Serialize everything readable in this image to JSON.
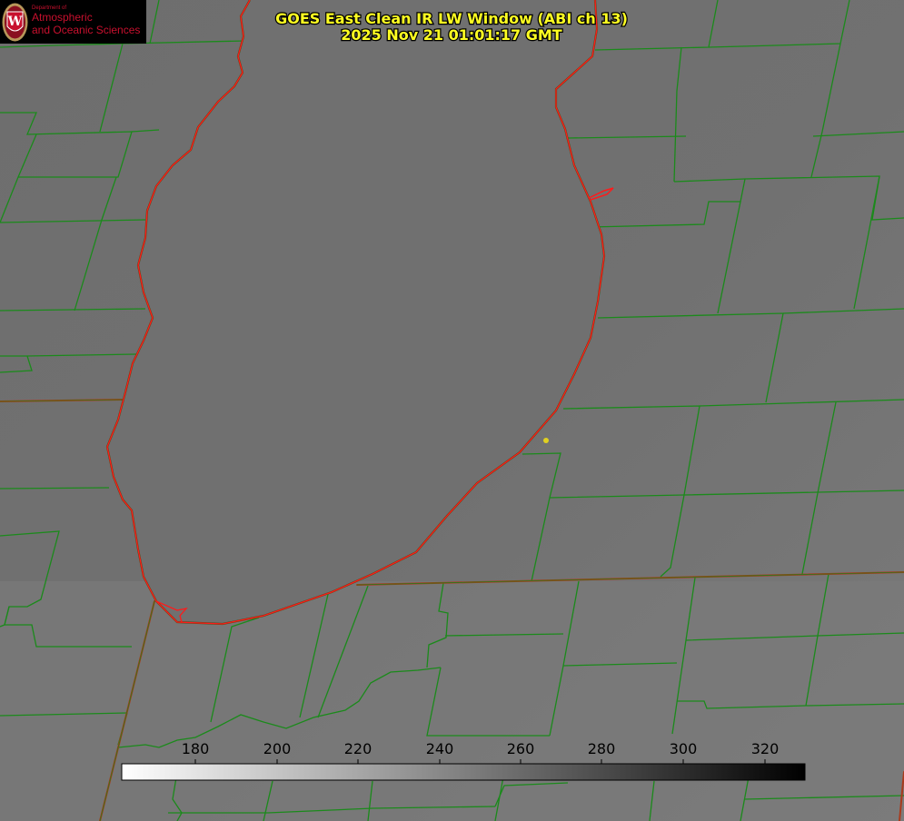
{
  "title": {
    "line1": "GOES East Clean IR LW Window (ABI ch 13)",
    "line2": "2025 Nov 21 01:01:17 GMT",
    "color": "#ffff22"
  },
  "logo": {
    "dept": "Department of",
    "line1": "Atmospheric",
    "line2": "and Oceanic Sciences",
    "seal_letter": "W",
    "icon": "uw-crest-icon",
    "text_color": "#c8102e"
  },
  "colorbar": {
    "ticks": [
      "180",
      "200",
      "220",
      "240",
      "260",
      "280",
      "300",
      "320"
    ],
    "cmap": "white-to-black grayscale"
  },
  "map": {
    "county_line_color": "#1b8a1b",
    "state_line_color": "#c0392b",
    "lake_shore_color": "#ff1a1a",
    "marker_color": "#e0d020"
  }
}
